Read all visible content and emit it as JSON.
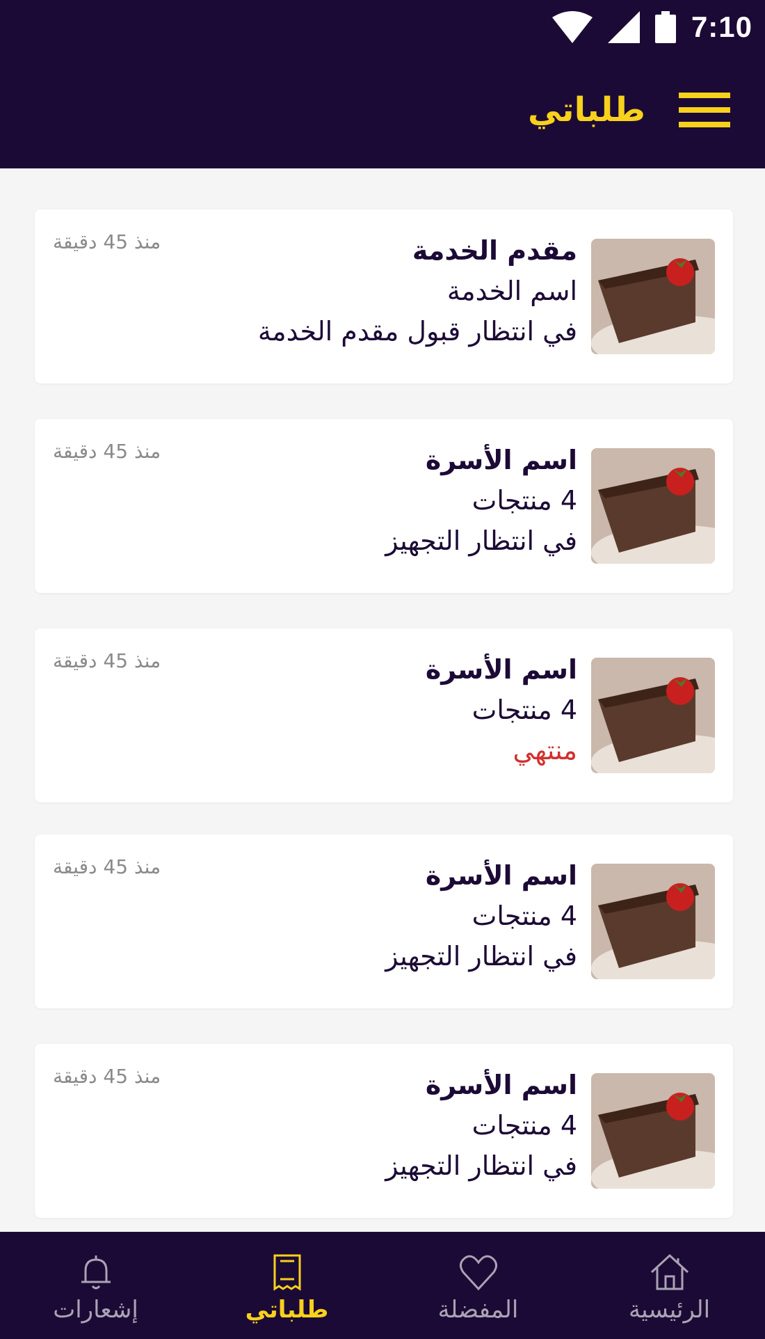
{
  "status_bar": {
    "time": "7:10"
  },
  "header": {
    "title": "طلباتي"
  },
  "orders": [
    {
      "title": "مقدم الخدمة",
      "subtitle": "اسم الخدمة",
      "status": "في انتظار قبول مقدم الخدمة",
      "time": "منذ 45 دقيقة",
      "state": "pending"
    },
    {
      "title": "اسم الأسرة",
      "subtitle": "4 منتجات",
      "status": "في انتظار التجهيز",
      "time": "منذ 45 دقيقة",
      "state": "pending"
    },
    {
      "title": "اسم الأسرة",
      "subtitle": "4 منتجات",
      "status": "منتهي",
      "time": "منذ 45 دقيقة",
      "state": "ended"
    },
    {
      "title": "اسم الأسرة",
      "subtitle": "4 منتجات",
      "status": "في انتظار التجهيز",
      "time": "منذ 45 دقيقة",
      "state": "pending"
    },
    {
      "title": "اسم الأسرة",
      "subtitle": "4 منتجات",
      "status": "في انتظار التجهيز",
      "time": "منذ 45 دقيقة",
      "state": "pending"
    }
  ],
  "bottom_nav": [
    {
      "label": "إشعارات",
      "icon": "bell-icon",
      "active": false
    },
    {
      "label": "طلباتي",
      "icon": "receipt-icon",
      "active": true
    },
    {
      "label": "المفضلة",
      "icon": "heart-icon",
      "active": false
    },
    {
      "label": "الرئيسية",
      "icon": "home-icon",
      "active": false
    }
  ],
  "colors": {
    "primary": "#1c0a36",
    "accent": "#f7d11b",
    "ended": "#d32f2f"
  }
}
